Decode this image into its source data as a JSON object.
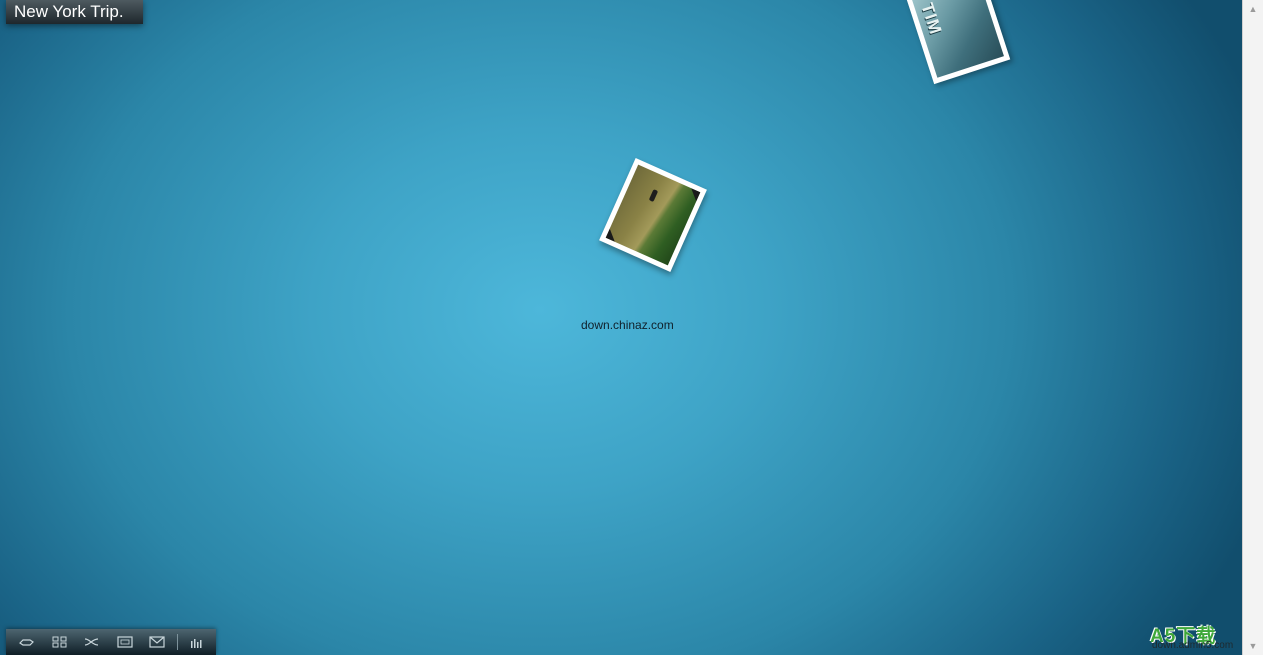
{
  "album": {
    "title": "New York Trip."
  },
  "gallery": {
    "caption": "down.chinaz.com",
    "photos": [
      {
        "name": "park-photo"
      },
      {
        "name": "times-sign-photo",
        "sign_text": "TIM"
      }
    ]
  },
  "toolbar": {
    "items": [
      {
        "name": "hand-icon"
      },
      {
        "name": "grid-icon"
      },
      {
        "name": "shuffle-icon"
      },
      {
        "name": "fullscreen-icon"
      },
      {
        "name": "mail-icon"
      },
      {
        "name": "equalizer-icon"
      }
    ]
  },
  "watermark": {
    "logo": "A5下载",
    "url": "down.admin5.com"
  },
  "colors": {
    "background_center": "#4db7da",
    "background_edge": "#114e6d",
    "toolbar": "#0f1e26",
    "watermark": "#3fa83a"
  }
}
